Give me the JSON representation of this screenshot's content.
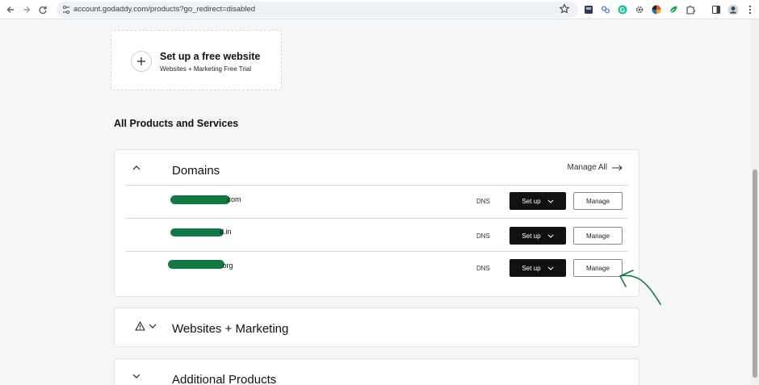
{
  "browser": {
    "url": "account.godaddy.com/products?go_redirect=disabled"
  },
  "free_website": {
    "title": "Set up a free website",
    "subtitle": "Websites + Marketing Free Trial"
  },
  "section_title": "All Products and Services",
  "domains": {
    "title": "Domains",
    "manage_all": "Manage All",
    "rows": [
      {
        "name_suffix": ".com",
        "dns": "DNS",
        "setup_label": "Set up",
        "manage_label": "Manage"
      },
      {
        "name_suffix": "d.in",
        "dns": "DNS",
        "setup_label": "Set up",
        "manage_label": "Manage"
      },
      {
        "name_suffix": ".org",
        "dns": "DNS",
        "setup_label": "Set up",
        "manage_label": "Manage"
      }
    ]
  },
  "websites": {
    "title": "Websites + Marketing"
  },
  "additional": {
    "title": "Additional Products"
  },
  "colors": {
    "button_dark": "#111111",
    "redaction_green": "#0f7a43",
    "page_background": "#f5f6f7"
  },
  "icons": {
    "back": "arrow-left-icon",
    "forward": "arrow-right-icon",
    "reload": "reload-icon",
    "site_info": "tune-icon",
    "bookmark": "star-icon",
    "expand": "chevron-icon",
    "warning": "warning-icon",
    "add": "plus-icon"
  }
}
